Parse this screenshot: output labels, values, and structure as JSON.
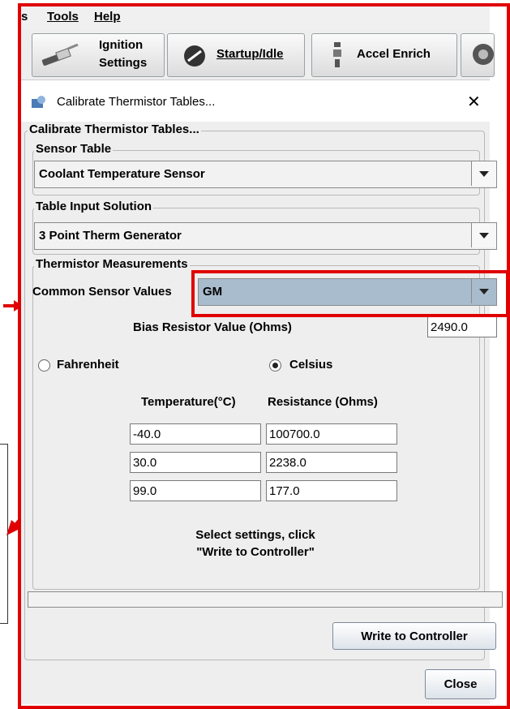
{
  "menu": {
    "items": [
      "s",
      "Tools",
      "Help"
    ]
  },
  "toolbar": {
    "ignition_line1": "Ignition",
    "ignition_line2": "Settings",
    "startup_label": "Startup/Idle",
    "accel_label": "Accel Enrich"
  },
  "dialog": {
    "title": "Calibrate Thermistor Tables...",
    "group_title": "Calibrate Thermistor Tables...",
    "sensor_table": {
      "legend": "Sensor Table",
      "value": "Coolant Temperature Sensor"
    },
    "table_input": {
      "legend": "Table Input Solution",
      "value": "3 Point Therm Generator"
    },
    "measurements": {
      "legend": "Thermistor Measurements",
      "common_label": "Common Sensor Values",
      "common_value": "GM",
      "bias_label": "Bias Resistor Value (Ohms)",
      "bias_value": "2490.0",
      "fahrenheit_label": "Fahrenheit",
      "celsius_label": "Celsius",
      "selected_unit": "Celsius",
      "temp_header": "Temperature(°C)",
      "res_header": "Resistance (Ohms)",
      "rows": [
        {
          "temp": "-40.0",
          "res": "100700.0"
        },
        {
          "temp": "30.0",
          "res": "2238.0"
        },
        {
          "temp": "99.0",
          "res": "177.0"
        }
      ]
    },
    "instructions_line1": "Select settings, click",
    "instructions_line2": "\"Write to Controller\"",
    "progress": 0,
    "write_button": "Write to Controller",
    "close_button": "Close"
  },
  "colors": {
    "annotation": "#e00000",
    "selected_combo": "#a9bccd"
  }
}
